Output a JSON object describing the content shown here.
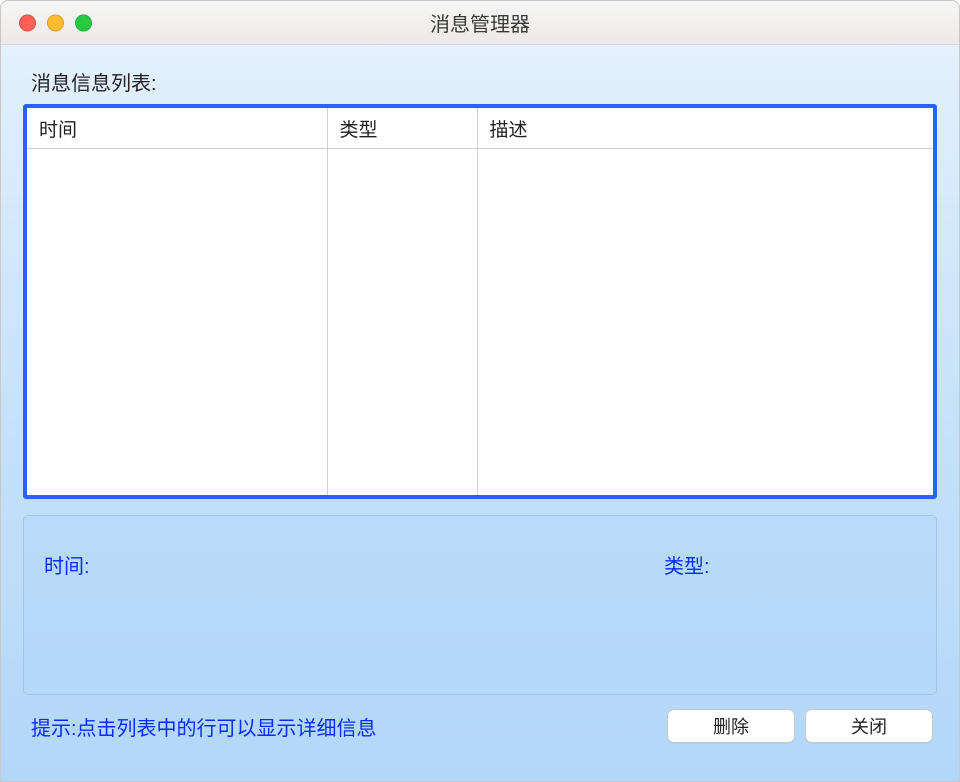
{
  "window": {
    "title": "消息管理器"
  },
  "list": {
    "label": "消息信息列表:",
    "columns": {
      "time": "时间",
      "type": "类型",
      "desc": "描述"
    },
    "rows": []
  },
  "detail": {
    "time_label": "时间:",
    "type_label": "类型:"
  },
  "footer": {
    "hint": "提示:点击列表中的行可以显示详细信息",
    "delete_label": "删除",
    "close_label": "关闭"
  }
}
